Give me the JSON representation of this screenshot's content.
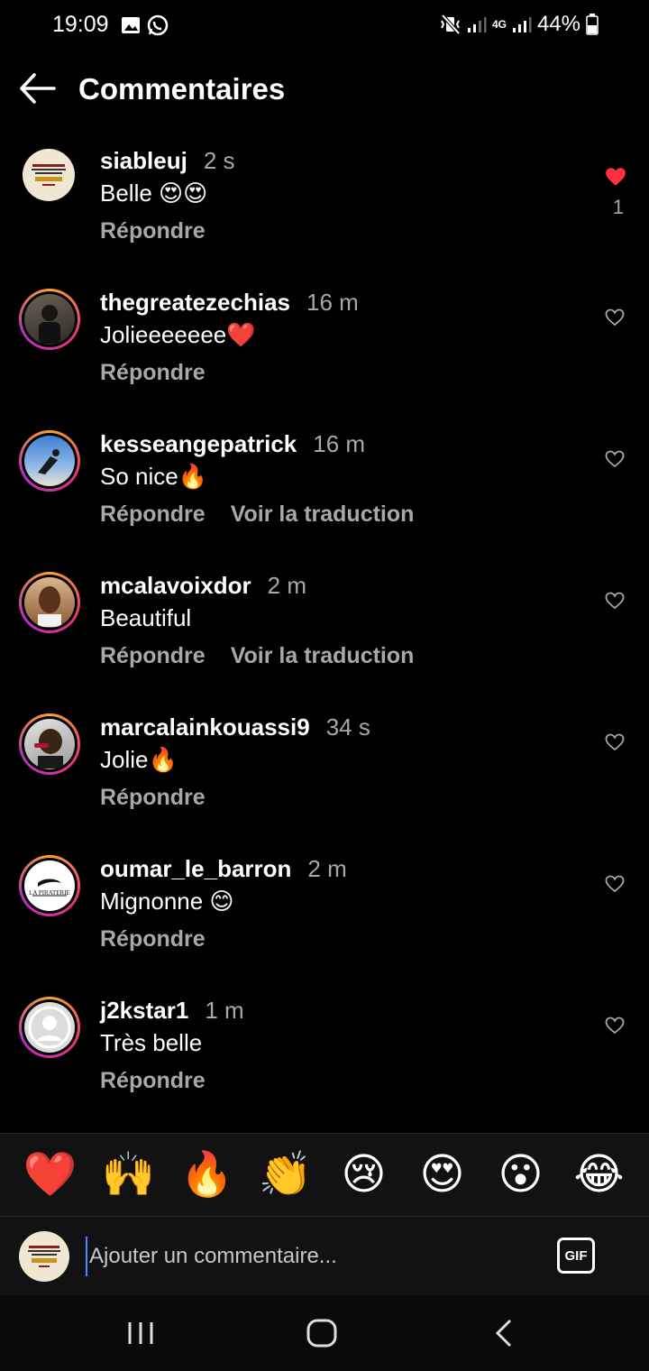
{
  "status_bar": {
    "time": "19:09",
    "network": "4G",
    "battery": "44%"
  },
  "header": {
    "title": "Commentaires"
  },
  "comments": [
    {
      "username": "siableuj",
      "time": "2 s",
      "text": "Belle 😍😍",
      "reply": "Répondre",
      "liked": true,
      "likes": "1",
      "avatar": "logo-cest-jesus"
    },
    {
      "username": "thegreatezechias",
      "time": "16 m",
      "text": "Jolieeeeeee❤️",
      "reply": "Répondre",
      "liked": false,
      "avatar": "photo-person"
    },
    {
      "username": "kesseangepatrick",
      "time": "16 m",
      "text": "So nice🔥",
      "reply": "Répondre",
      "translate": "Voir la traduction",
      "liked": false,
      "avatar": "photo-sky"
    },
    {
      "username": "mcalavoixdor",
      "time": "2 m",
      "text": "Beautiful",
      "reply": "Répondre",
      "translate": "Voir la traduction",
      "liked": false,
      "avatar": "photo-face"
    },
    {
      "username": "marcalainkouassi9",
      "time": "34 s",
      "text": "Jolie🔥",
      "reply": "Répondre",
      "liked": false,
      "avatar": "photo-person"
    },
    {
      "username": "oumar_le_barron",
      "time": "2 m",
      "text": "Mignonne 😊",
      "reply": "Répondre",
      "liked": false,
      "avatar": "logo-la-piraterie"
    },
    {
      "username": "j2kstar1",
      "time": "1 m",
      "text": "Très belle",
      "reply": "Répondre",
      "liked": false,
      "avatar": "default-avatar"
    }
  ],
  "emoji_bar": [
    "❤️",
    "🙌",
    "🔥",
    "👏",
    "😢",
    "😍",
    "😮",
    "😂"
  ],
  "composer": {
    "placeholder": "Ajouter un commentaire...",
    "gif_label": "GIF"
  },
  "colors": {
    "background": "#000000",
    "secondary_text": "#a8a8a8",
    "like_red": "#ff3040"
  }
}
